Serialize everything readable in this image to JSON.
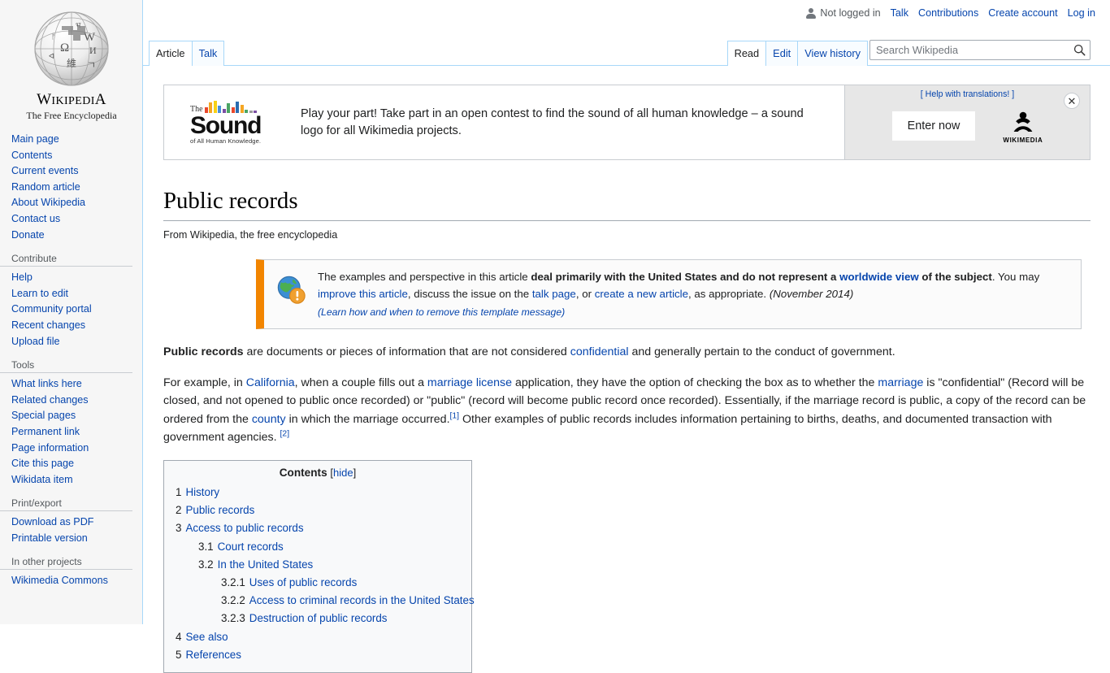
{
  "personal_bar": {
    "user_icon": "user-icon",
    "not_logged_in": "Not logged in",
    "links": [
      "Talk",
      "Contributions",
      "Create account",
      "Log in"
    ]
  },
  "sidebar": {
    "logo": {
      "icon": "wikipedia-globe-icon",
      "wordmark_w": "W",
      "wordmark_rest": "IKIPEDI",
      "wordmark_a": "A",
      "tagline": "The Free Encyclopedia"
    },
    "portals": [
      {
        "heading": "",
        "items": [
          "Main page",
          "Contents",
          "Current events",
          "Random article",
          "About Wikipedia",
          "Contact us",
          "Donate"
        ]
      },
      {
        "heading": "Contribute",
        "items": [
          "Help",
          "Learn to edit",
          "Community portal",
          "Recent changes",
          "Upload file"
        ]
      },
      {
        "heading": "Tools",
        "items": [
          "What links here",
          "Related changes",
          "Special pages",
          "Permanent link",
          "Page information",
          "Cite this page",
          "Wikidata item"
        ]
      },
      {
        "heading": "Print/export",
        "items": [
          "Download as PDF",
          "Printable version"
        ]
      },
      {
        "heading": "In other projects",
        "items": [
          "Wikimedia Commons"
        ]
      }
    ]
  },
  "tabs": {
    "namespace": [
      {
        "label": "Article",
        "selected": true
      },
      {
        "label": "Talk",
        "selected": false
      }
    ],
    "views": [
      {
        "label": "Read",
        "selected": true
      },
      {
        "label": "Edit",
        "selected": false
      },
      {
        "label": "View history",
        "selected": false
      }
    ]
  },
  "search": {
    "placeholder": "Search Wikipedia",
    "value": "",
    "icon": "search-icon"
  },
  "banner": {
    "logo": {
      "the": "The",
      "sound": "Sound",
      "subtitle": "of All Human Knowledge.",
      "equalizer_colors": [
        "#e8482c",
        "#f5a623",
        "#f7d117",
        "#4a90d9",
        "#7b4ea3",
        "#4aa564",
        "#e8482c",
        "#f5a623",
        "#2b6cb0",
        "#7b4ea3",
        "#4aa564",
        "#9b9b9b"
      ]
    },
    "text": "Play your part! Take part in an open contest to find the sound of all human knowledge – a sound logo for all Wikimedia projects.",
    "help_translations": "[ Help with translations! ]",
    "enter_now": "Enter now",
    "wikimedia_label": "WIKIMEDIA",
    "wikimedia_icon": "wikimedia-logo-icon",
    "close_icon": "close-icon",
    "close_glyph": "✕"
  },
  "article": {
    "title": "Public records",
    "site_sub": "From Wikipedia, the free encyclopedia",
    "ambox": {
      "icon": "globe-warning-icon",
      "seg1": "The examples and perspective in this article ",
      "bold1": "deal primarily with the United States and do not represent a ",
      "link_worldwide": "worldwide view",
      "bold2": " of the subject",
      "seg2": ". You may ",
      "link_improve": "improve this article",
      "seg3": ", discuss the issue on the ",
      "link_talk": "talk page",
      "seg4": ", or ",
      "link_create": "create a new article",
      "seg5": ", as appropriate. ",
      "date": "(November 2014)",
      "learn_more": "(Learn how and when to remove this template message)"
    },
    "paragraphs": [
      {
        "bold_lead": "Public records",
        "seg1": " are documents or pieces of information that are not considered ",
        "link1": "confidential",
        "seg2": " and generally pertain to the conduct of government."
      },
      {
        "seg1": "For example, in ",
        "link1": "California",
        "seg2": ", when a couple fills out a ",
        "link2": "marriage license",
        "seg3": " application, they have the option of checking the box as to whether the ",
        "link3": "marriage",
        "seg4": " is \"confidential\" (Record will be closed, and not opened to public once recorded) or \"public\" (record will become public record once recorded). Essentially, if the marriage record is public, a copy of the record can be ordered from the ",
        "link4": "county",
        "seg5": " in which the marriage occurred.",
        "ref1": "[1]",
        "seg6": " Other examples of public records includes information pertaining to births, deaths, and documented transaction with government agencies. ",
        "ref2": "[2]"
      }
    ],
    "toc": {
      "title": "Contents",
      "bracket_open": "[",
      "hide": "hide",
      "bracket_close": "]",
      "entries": [
        {
          "num": "1",
          "label": "History",
          "level": 1
        },
        {
          "num": "2",
          "label": "Public records",
          "level": 1
        },
        {
          "num": "3",
          "label": "Access to public records",
          "level": 1
        },
        {
          "num": "3.1",
          "label": "Court records",
          "level": 2
        },
        {
          "num": "3.2",
          "label": "In the United States",
          "level": 2
        },
        {
          "num": "3.2.1",
          "label": "Uses of public records",
          "level": 3
        },
        {
          "num": "3.2.2",
          "label": "Access to criminal records in the United States",
          "level": 3
        },
        {
          "num": "3.2.3",
          "label": "Destruction of public records",
          "level": 3
        },
        {
          "num": "4",
          "label": "See also",
          "level": 1
        },
        {
          "num": "5",
          "label": "References",
          "level": 1
        }
      ]
    }
  }
}
